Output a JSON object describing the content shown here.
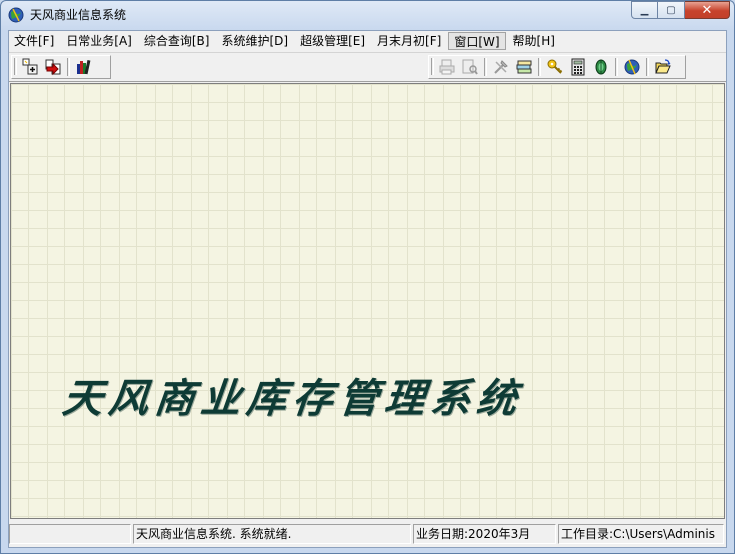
{
  "window": {
    "title": "天风商业信息系统"
  },
  "menu": [
    {
      "label": "文件[F]",
      "active": false
    },
    {
      "label": "日常业务[A]",
      "active": false
    },
    {
      "label": "综合查询[B]",
      "active": false
    },
    {
      "label": "系统维护[D]",
      "active": false
    },
    {
      "label": "超级管理[E]",
      "active": false
    },
    {
      "label": "月末月初[F]",
      "active": false
    },
    {
      "label": "窗口[W]",
      "active": true
    },
    {
      "label": "帮助[H]",
      "active": false
    }
  ],
  "toolbar": {
    "left_icons": [
      "add-record-icon",
      "open-red-icon",
      "books-icon"
    ],
    "right_icons": [
      "print-icon",
      "print-preview-icon",
      "tools-icon",
      "card-icon",
      "key-icon",
      "calculator-icon",
      "green-gem-icon",
      "globe-icon",
      "open-folder-icon"
    ]
  },
  "splash": {
    "text": "天风商业库存管理系统"
  },
  "status": {
    "message": "天风商业信息系统. 系统就绪.",
    "business_date": "业务日期:2020年3月",
    "work_dir": "工作目录:C:\\Users\\Adminis"
  },
  "colors": {
    "splash_text": "#0e3b35",
    "background": "#f4f4e2"
  }
}
